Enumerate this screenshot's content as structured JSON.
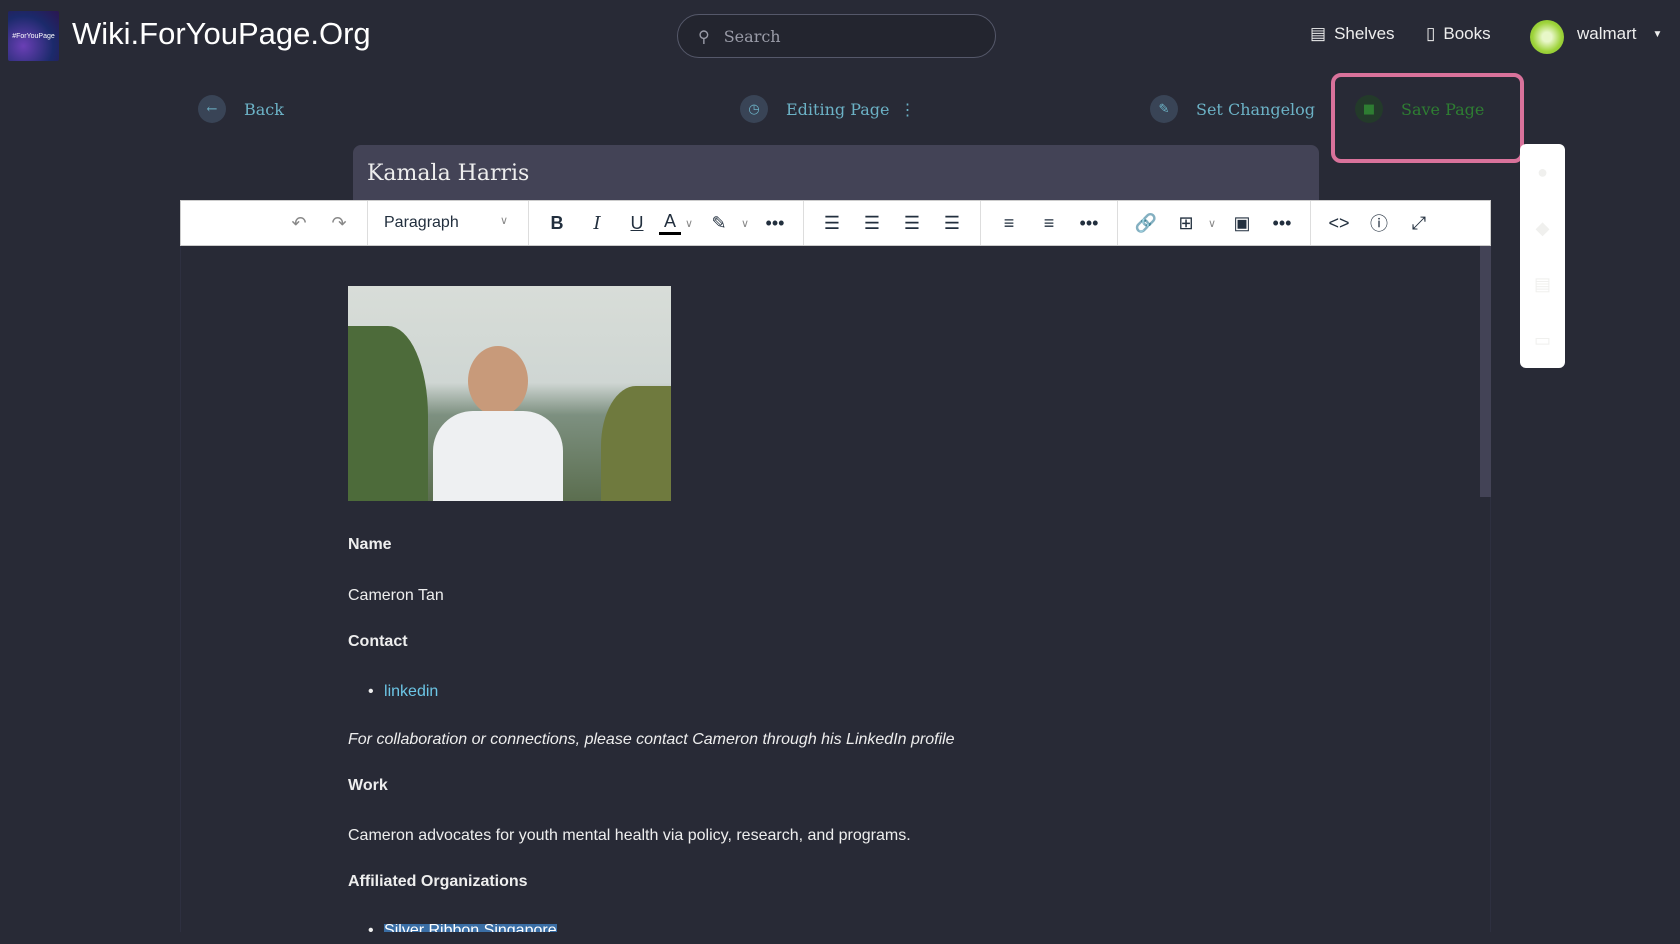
{
  "header": {
    "site_title": "Wiki.ForYouPage.Org",
    "logo_text": "#ForYouPage",
    "search_placeholder": "Search",
    "nav": [
      {
        "label": "Shelves",
        "icon": "shelves-icon"
      },
      {
        "label": "Books",
        "icon": "book-icon"
      }
    ],
    "user": "walmart"
  },
  "actions": {
    "back": "Back",
    "editing": "Editing Page",
    "changelog": "Set Changelog",
    "save": "Save Page"
  },
  "page_title": "Kamala Harris",
  "toolbar": {
    "block_format": "Paragraph"
  },
  "content": {
    "h_name": "Name",
    "name": "Cameron Tan",
    "h_contact": "Contact",
    "link": "linkedin",
    "note": "For collaboration or connections, please contact Cameron through his LinkedIn profile",
    "h_work": "Work",
    "work": "Cameron advocates for youth mental health via policy, research, and programs.",
    "h_orgs": "Affiliated Organizations",
    "org1": "Silver Ribbon Singapore"
  },
  "colors": {
    "accent": "#6cb2c6",
    "save": "#2e7d32",
    "highlight_box": "#d9729b",
    "bg": "#282a36"
  }
}
